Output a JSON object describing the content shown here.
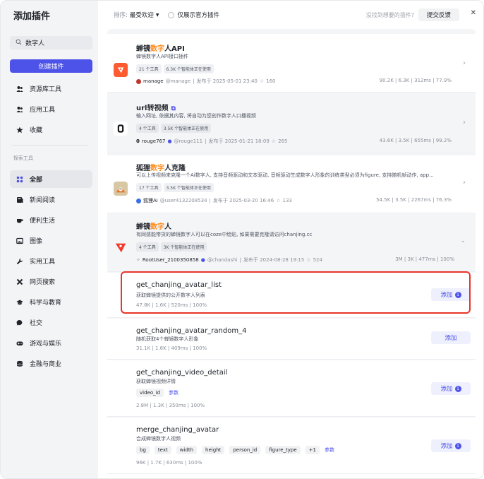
{
  "sidebar": {
    "title": "添加插件",
    "search_value": "数字人",
    "create_label": "创建插件",
    "items_top": [
      {
        "label": "资源库工具",
        "icon": "users-icon"
      },
      {
        "label": "应用工具",
        "icon": "users-icon"
      },
      {
        "label": "收藏",
        "icon": "star-icon"
      }
    ],
    "section_label": "探索工具",
    "items_explore": [
      {
        "label": "全部",
        "icon": "grid-icon"
      },
      {
        "label": "新闻阅读",
        "icon": "newspaper-icon"
      },
      {
        "label": "便利生活",
        "icon": "cup-icon"
      },
      {
        "label": "图像",
        "icon": "image-icon"
      },
      {
        "label": "实用工具",
        "icon": "wrench-icon"
      },
      {
        "label": "网页搜索",
        "icon": "cross-icon"
      },
      {
        "label": "科学与教育",
        "icon": "cap-icon"
      },
      {
        "label": "社交",
        "icon": "chat-icon"
      },
      {
        "label": "游戏与娱乐",
        "icon": "gamepad-icon"
      },
      {
        "label": "金融与商业",
        "icon": "coins-icon"
      }
    ]
  },
  "topbar": {
    "sort_label": "排序:",
    "sort_value": "最受欢迎",
    "official_label": "仅展示官方插件",
    "hint": "没找到想要的插件?",
    "feedback_label": "提交反馈"
  },
  "plugins": [
    {
      "name_pre": "蝉镜",
      "name_hl": "数字",
      "name_post": "人API",
      "desc": "蝉镜数字人API接口插件",
      "tag1": "21 个工具",
      "tag2": "6.3K 个智能体正在使用",
      "user": "manage",
      "handle": "@manage",
      "published": "发布于 2025-05-01 23:40",
      "favs": "160",
      "stats": "90.2K  |  6.3K  |  312ms  |  77.9%"
    },
    {
      "name_pre": "url转视频",
      "name_hl": "",
      "name_post": "",
      "desc": "输入网址, 依据其内容, 将自动为您创作数字人口播视频",
      "tag1": "4 个工具",
      "tag2": "3.5K 个智能体正在使用",
      "user": "rouge767",
      "handle": "@rouge111",
      "published": "发布于 2025-01-21 18:09",
      "favs": "265",
      "stats": "43.6K  |  3.5K  |  655ms  |  99.2%"
    },
    {
      "name_pre": "狐狸",
      "name_hl": "数字",
      "name_post": "人克隆",
      "desc": "可以上传视频来克隆一个Ai数字人, 支持音频驱动和文本驱动, 音频驱动生成数字人形象的训练类型必须为figure, 支持随机帧动作, app...",
      "tag1": "17 个工具",
      "tag2": "3.5K 个智能体正在使用",
      "user": "狐狸Ai",
      "handle": "@user4132208534",
      "published": "发布于 2025-03-20 16:46",
      "favs": "133",
      "stats": "54.5K  |  3.5K  |  2267ms  |  76.3%"
    },
    {
      "name_pre": "蝉镜",
      "name_hl": "数字",
      "name_post": "人",
      "desc": "有同感能带货的蝉镜数字人可以在coze中绘贴, 如果需要克隆请访问chanjing.cc",
      "tag1": "4 个工具",
      "tag2": "3K 个智能体正在使用",
      "user": "RootUser_2100350858",
      "handle": "@chandashi",
      "published": "发布于 2024-08-28 19:15",
      "favs": "524",
      "stats": "3M  |  3K  |  477ms  |  100%"
    }
  ],
  "tools": [
    {
      "name": "get_chanjing_avatar_list",
      "desc": "获取蝉镜提供的公开数字人列表",
      "stats": "47.8K  |  1.6K  |  520ms  |  100%",
      "add_label": "添加",
      "count": "1",
      "params": []
    },
    {
      "name": "get_chanjing_avatar_random_4",
      "desc": "随机获取4个蝉镜数字人形象",
      "stats": "31.1K  |  1.6K  |  409ms  |  100%",
      "add_label": "添加",
      "count": "",
      "params": []
    },
    {
      "name": "get_chanjing_video_detail",
      "desc": "获取蝉镜视频详情",
      "stats": "2.8M  |  1.3K  |  350ms  |  100%",
      "add_label": "添加",
      "count": "1",
      "params": [
        "video_id"
      ],
      "params_link": "参数"
    },
    {
      "name": "merge_chanjing_avatar",
      "desc": "合成蝉镜数字人视频",
      "stats": "96K  |  1.7K  |  630ms  |  100%",
      "add_label": "添加",
      "count": "1",
      "params": [
        "bg",
        "text",
        "width",
        "height",
        "person_id",
        "figure_type",
        "+1"
      ],
      "params_link": "参数"
    }
  ],
  "colors": {
    "accent": "#4d53e8",
    "highlight": "#ff8a1c",
    "outline": "#e8342a"
  }
}
